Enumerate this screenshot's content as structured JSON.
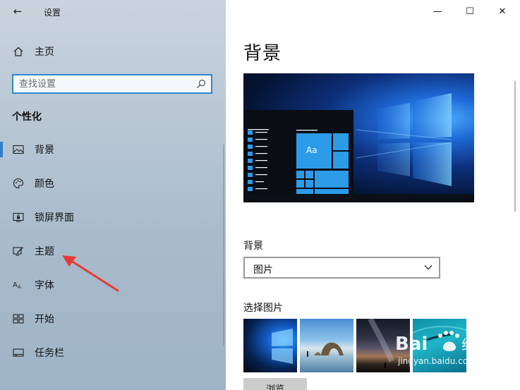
{
  "window": {
    "app_title": "设置",
    "controls": {
      "minimize": "—",
      "maximize": "☐",
      "close": "✕"
    }
  },
  "sidebar": {
    "back_glyph": "←",
    "home_label": "主页",
    "search": {
      "placeholder": "查找设置",
      "value": ""
    },
    "section_title": "个性化",
    "items": [
      {
        "label": "背景",
        "icon": "picture-icon",
        "active": true
      },
      {
        "label": "颜色",
        "icon": "palette-icon",
        "active": false
      },
      {
        "label": "锁屏界面",
        "icon": "lock-screen-icon",
        "active": false
      },
      {
        "label": "主题",
        "icon": "theme-brush-icon",
        "active": false
      },
      {
        "label": "字体",
        "icon": "font-icon",
        "active": false
      },
      {
        "label": "开始",
        "icon": "start-tiles-icon",
        "active": false
      },
      {
        "label": "任务栏",
        "icon": "taskbar-icon",
        "active": false
      }
    ]
  },
  "content": {
    "page_title": "背景",
    "preview": {
      "sample_text": "Aa"
    },
    "background_label": "背景",
    "background_dropdown": {
      "selected": "图片"
    },
    "choose_picture_label": "选择图片",
    "thumbnails": [
      "windows-blue-wallpaper",
      "beach-rock-arch",
      "milky-way-night",
      "underwater-swimmer"
    ],
    "browse_button": "浏览"
  },
  "watermark": {
    "brand": "Bai",
    "brand_cn": "经验",
    "url": "jingyan.baidu.com"
  },
  "colors": {
    "accent": "#2f7fc8",
    "search_border": "#2f89d3",
    "arrow": "#e53a36",
    "tile": "#2c9be8"
  }
}
